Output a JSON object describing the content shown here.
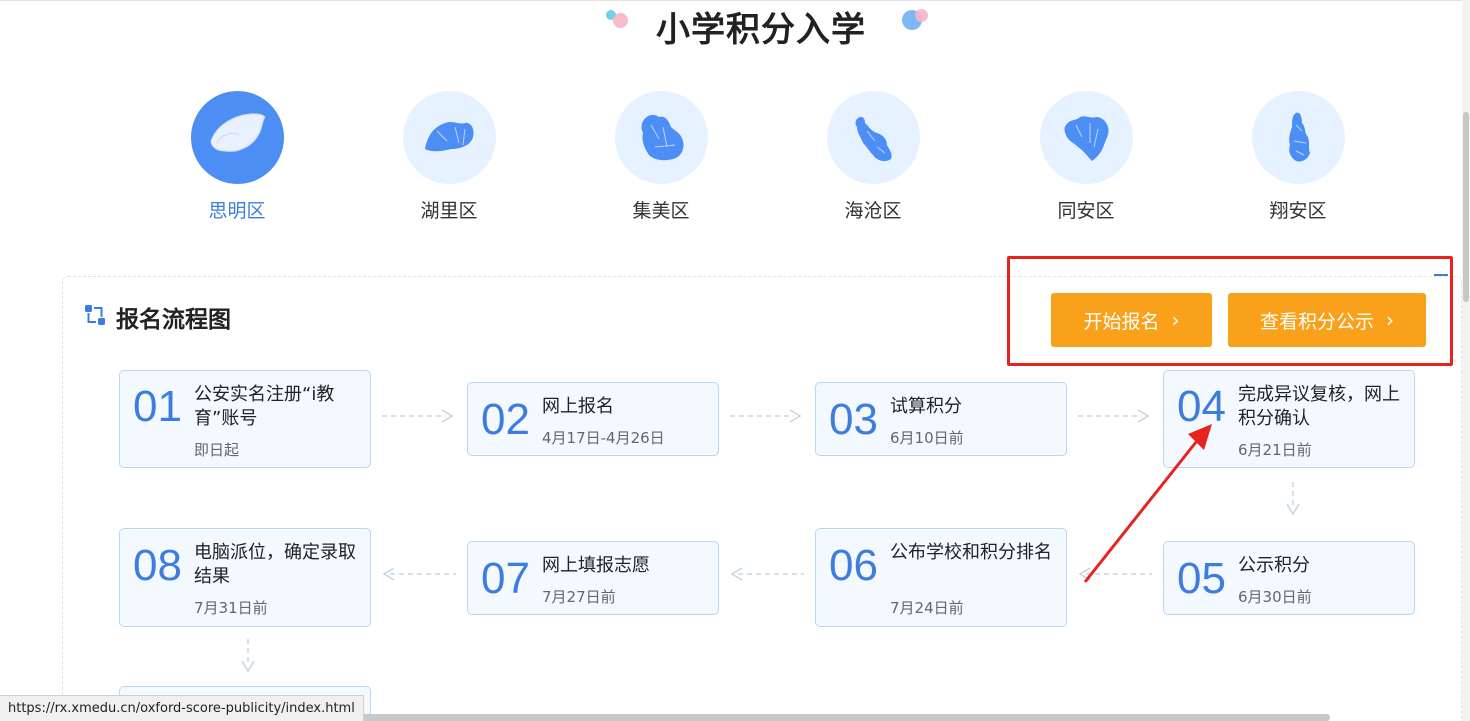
{
  "page": {
    "title": "小学积分入学"
  },
  "districts": [
    {
      "name": "思明区",
      "active": true
    },
    {
      "name": "湖里区",
      "active": false
    },
    {
      "name": "集美区",
      "active": false
    },
    {
      "name": "海沧区",
      "active": false
    },
    {
      "name": "同安区",
      "active": false
    },
    {
      "name": "翔安区",
      "active": false
    }
  ],
  "flow": {
    "title": "报名流程图",
    "steps": [
      {
        "num": "01",
        "name": "公安实名注册“i教育”账号",
        "date": "即日起"
      },
      {
        "num": "02",
        "name": "网上报名",
        "date": "4月17日-4月26日"
      },
      {
        "num": "03",
        "name": "试算积分",
        "date": "6月10日前"
      },
      {
        "num": "04",
        "name": "完成异议复核，网上积分确认",
        "date": "6月21日前"
      },
      {
        "num": "05",
        "name": "公示积分",
        "date": "6月30日前"
      },
      {
        "num": "06",
        "name": "公布学校和积分排名",
        "date": "7月24日前"
      },
      {
        "num": "07",
        "name": "网上填报志愿",
        "date": "7月27日前"
      },
      {
        "num": "08",
        "name": "电脑派位，确定录取结果",
        "date": "7月31日前"
      }
    ]
  },
  "actions": {
    "start_label": "开始报名",
    "view_label": "查看积分公示"
  },
  "status": {
    "url": "https://rx.xmedu.cn/oxford-score-publicity/index.html"
  },
  "colors": {
    "accent": "#3d7de0",
    "button": "#f9a11b",
    "highlight": "#e8231f"
  }
}
